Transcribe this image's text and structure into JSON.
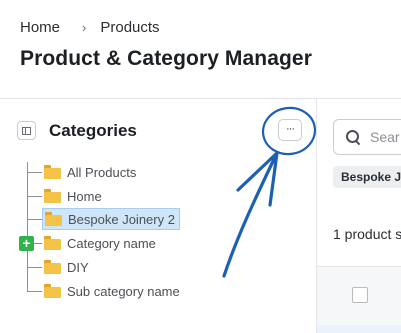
{
  "breadcrumb": {
    "items": [
      "Home",
      "Products"
    ],
    "separator": "›"
  },
  "page": {
    "title": "Product & Category Manager"
  },
  "categories_panel": {
    "title": "Categories",
    "toggle_icon": "sidebar-panel-icon",
    "more_button_label": "···",
    "add_icon": "plus-icon",
    "tree": [
      {
        "label": "All Products",
        "icon": "folder-icon",
        "selected": false
      },
      {
        "label": "Home",
        "icon": "folder-icon",
        "selected": false
      },
      {
        "label": "Bespoke Joinery 2",
        "icon": "folder-icon",
        "selected": true
      },
      {
        "label": "Category name",
        "icon": "folder-icon",
        "selected": false
      },
      {
        "label": "DIY",
        "icon": "folder-icon",
        "selected": false
      },
      {
        "label": "Sub category name",
        "icon": "folder-icon",
        "selected": false
      }
    ]
  },
  "products_panel": {
    "search": {
      "placeholder": "Sear",
      "icon": "search-icon"
    },
    "filter_chip": "Bespoke J",
    "count_text": "1 product s"
  },
  "colors": {
    "selection_bg": "#cfe5f8",
    "folder": "#f3c247",
    "add_badge": "#2fb34a",
    "annotation": "#1d5fb3"
  }
}
